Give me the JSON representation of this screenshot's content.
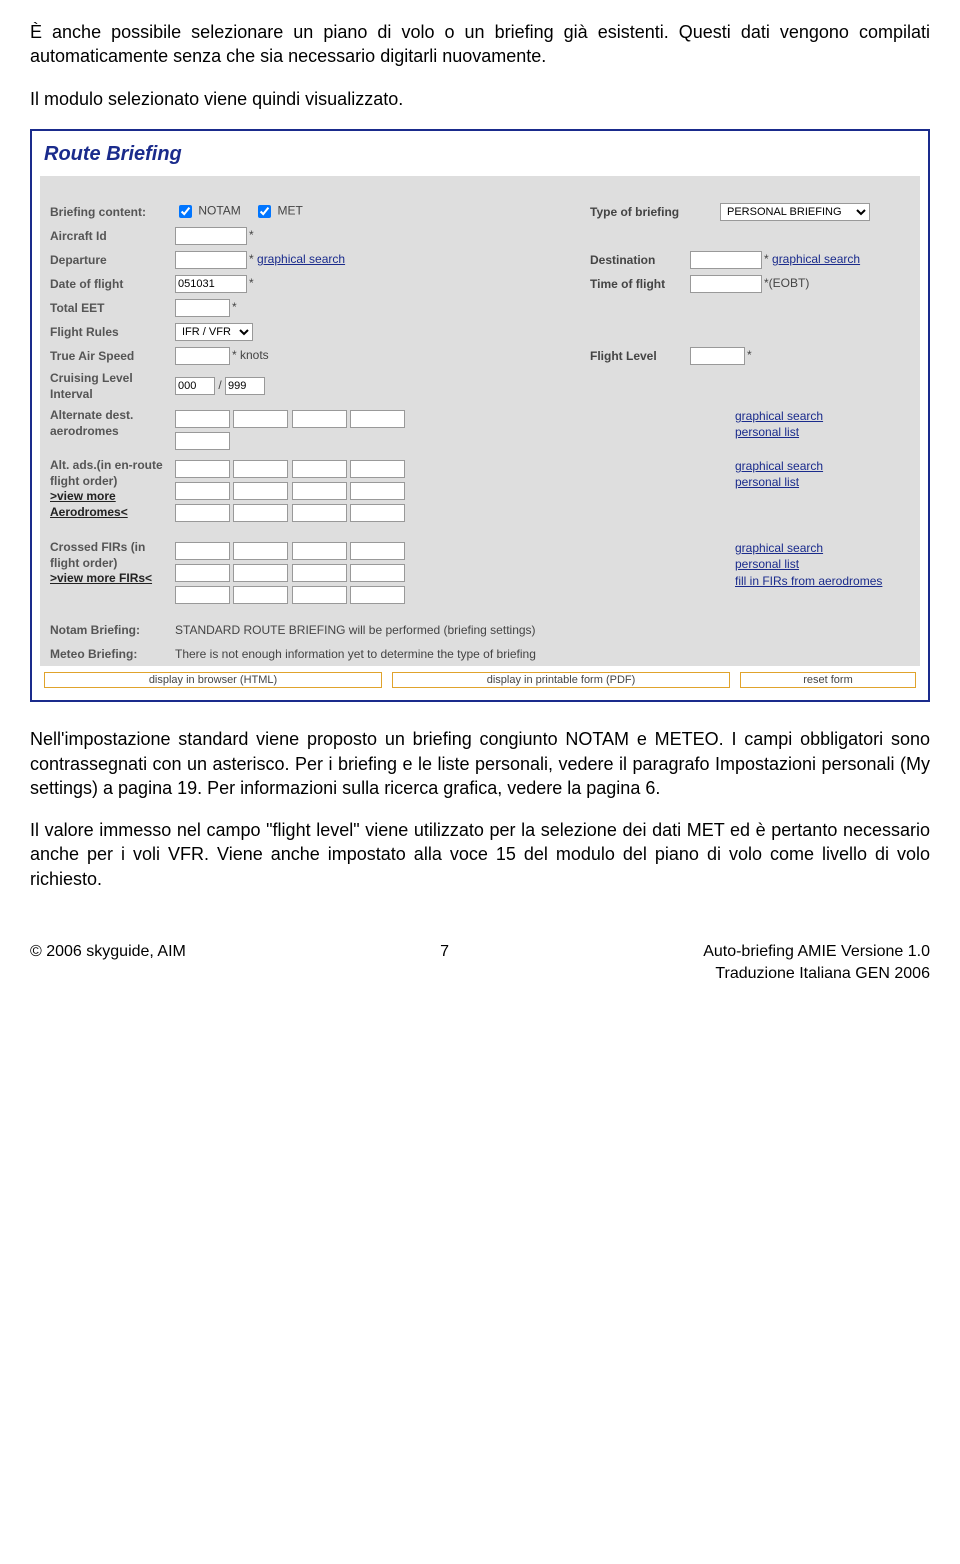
{
  "para": {
    "top1": "È anche possibile selezionare un piano di volo o un briefing già esistenti. Questi dati vengono compilati automaticamente senza che sia necessario digitarli nuovamente.",
    "top2": "Il modulo selezionato viene quindi visualizzato.",
    "mid1": "Nell'impostazione standard viene proposto un briefing congiunto NOTAM e METEO. I campi obbligatori sono contrassegnati con un asterisco. Per i briefing e le liste personali, vedere il paragrafo Impostazioni personali (My settings) a pagina 19. Per informazioni sulla ricerca grafica, vedere la pagina 6.",
    "mid2": "Il valore immesso nel campo \"flight level\" viene utilizzato per la selezione dei dati MET ed è pertanto necessario anche per i voli VFR. Viene anche impostato alla voce 15 del modulo del piano di volo come livello di volo richiesto."
  },
  "form": {
    "title": "Route Briefing",
    "labels": {
      "briefing_content": "Briefing content:",
      "notam": "NOTAM",
      "met": "MET",
      "type_of_briefing": "Type of briefing",
      "personal_briefing": "PERSONAL BRIEFING",
      "aircraft_id": "Aircraft Id",
      "departure": "Departure",
      "destination": "Destination",
      "date_of_flight": "Date of flight",
      "time_of_flight": "Time of flight",
      "eobt": "*(EOBT)",
      "total_eet": "Total EET",
      "flight_rules": "Flight Rules",
      "ifrvfr": "IFR / VFR",
      "tas": "True Air Speed",
      "knots": "* knots",
      "flight_level": "Flight Level",
      "cruising_level": "Cruising Level Interval",
      "alt_dest": "Alternate dest. aerodromes",
      "alt_ads": "Alt. ads.(in en-route flight order)",
      "view_more_aero": ">view more Aerodromes<",
      "crossed_firs": "Crossed FIRs (in flight order)",
      "view_more_firs": ">view more FIRs<",
      "notam_briefing": "Notam Briefing:",
      "meteo_briefing": "Meteo Briefing:",
      "notam_msg": "STANDARD ROUTE BRIEFING will be performed (briefing settings)",
      "meteo_msg": "There is not enough information yet to determine the type of briefing",
      "graphical_search": "graphical search",
      "personal_list": "personal list",
      "fill_firs": "fill in FIRs from aerodromes"
    },
    "values": {
      "date_of_flight": "051031",
      "cli_from": "000",
      "cli_to": "999",
      "slash": "/"
    },
    "buttons": {
      "html": "display in browser (HTML)",
      "pdf": "display in printable form (PDF)",
      "reset": "reset form"
    }
  },
  "footer": {
    "left": "© 2006 skyguide, AIM",
    "center": "7",
    "right1": "Auto-briefing AMIE Versione 1.0",
    "right2": "Traduzione Italiana GEN 2006"
  }
}
